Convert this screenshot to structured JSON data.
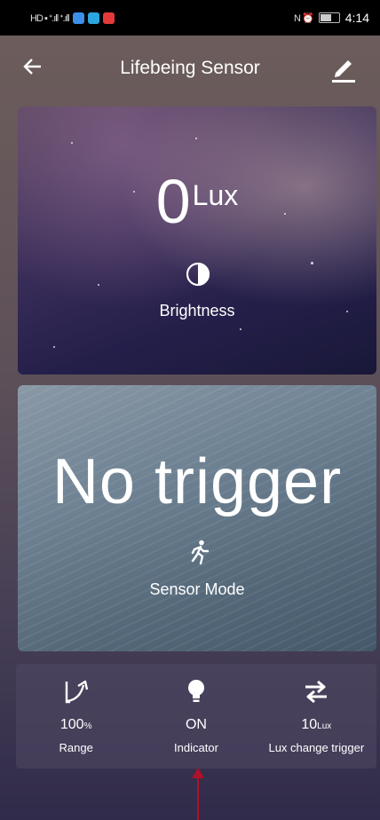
{
  "status_bar": {
    "left_glyphs": "HD ▪ ᐩ.ıll ᐩ.ıll",
    "time": "4:14",
    "right_glyphs": "N ⏰"
  },
  "header": {
    "title": "Lifebeing Sensor"
  },
  "brightness_card": {
    "value": "0",
    "unit": "Lux",
    "label": "Brightness"
  },
  "sensor_card": {
    "status": "No trigger",
    "label": "Sensor Mode"
  },
  "controls": [
    {
      "value": "100",
      "unit": "%",
      "label": "Range",
      "icon": "range-icon"
    },
    {
      "value": "ON",
      "unit": "",
      "label": "Indicator",
      "icon": "bulb-icon"
    },
    {
      "value": "10",
      "unit": "Lux",
      "label": "Lux change trigger",
      "icon": "swap-icon"
    }
  ],
  "colors": {
    "annotation_arrow": "#b0102a",
    "status_bar": "#000000"
  }
}
